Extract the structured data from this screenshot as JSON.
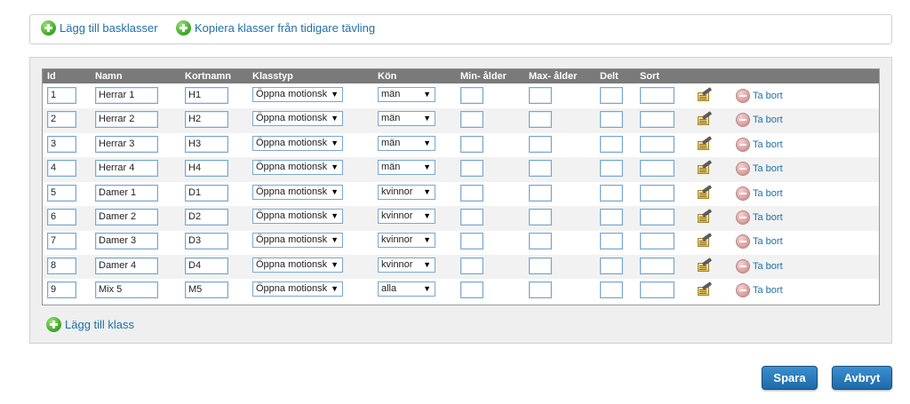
{
  "top_actions": {
    "add_base_classes": "Lägg till basklasser",
    "copy_classes": "Kopiera klasser från tidigare tävling"
  },
  "table": {
    "headers": {
      "id": "Id",
      "name": "Namn",
      "short_name": "Kortnamn",
      "class_type": "Klasstyp",
      "gender": "Kön",
      "min_age": "Min- ålder",
      "max_age": "Max- ålder",
      "split": "Delt",
      "sort": "Sort"
    },
    "rows": [
      {
        "id": "1",
        "name": "Herrar 1",
        "short": "H1",
        "type": "Öppna motionsk",
        "gender": "män",
        "min_age": "",
        "max_age": "",
        "split": "",
        "sort": ""
      },
      {
        "id": "2",
        "name": "Herrar 2",
        "short": "H2",
        "type": "Öppna motionsk",
        "gender": "män",
        "min_age": "",
        "max_age": "",
        "split": "",
        "sort": ""
      },
      {
        "id": "3",
        "name": "Herrar 3",
        "short": "H3",
        "type": "Öppna motionsk",
        "gender": "män",
        "min_age": "",
        "max_age": "",
        "split": "",
        "sort": ""
      },
      {
        "id": "4",
        "name": "Herrar 4",
        "short": "H4",
        "type": "Öppna motionsk",
        "gender": "män",
        "min_age": "",
        "max_age": "",
        "split": "",
        "sort": ""
      },
      {
        "id": "5",
        "name": "Damer 1",
        "short": "D1",
        "type": "Öppna motionsk",
        "gender": "kvinnor",
        "min_age": "",
        "max_age": "",
        "split": "",
        "sort": ""
      },
      {
        "id": "6",
        "name": "Damer 2",
        "short": "D2",
        "type": "Öppna motionsk",
        "gender": "kvinnor",
        "min_age": "",
        "max_age": "",
        "split": "",
        "sort": ""
      },
      {
        "id": "7",
        "name": "Damer 3",
        "short": "D3",
        "type": "Öppna motionsk",
        "gender": "kvinnor",
        "min_age": "",
        "max_age": "",
        "split": "",
        "sort": ""
      },
      {
        "id": "8",
        "name": "Damer 4",
        "short": "D4",
        "type": "Öppna motionsk",
        "gender": "kvinnor",
        "min_age": "",
        "max_age": "",
        "split": "",
        "sort": ""
      },
      {
        "id": "9",
        "name": "Mix 5",
        "short": "M5",
        "type": "Öppna motionsk",
        "gender": "alla",
        "min_age": "",
        "max_age": "",
        "split": "",
        "sort": ""
      }
    ],
    "delete_label": "Ta bort",
    "dropdown_arrow": "▼",
    "edit_icon": "edit-note-icon",
    "delete_icon": "minus-circle-icon"
  },
  "add_class": "Lägg till klass",
  "buttons": {
    "save": "Spara",
    "cancel": "Avbryt"
  },
  "colors": {
    "link": "#1f6fa8",
    "header_bg": "#7a7a7a",
    "button_bg": "#1f69a8",
    "add_icon": "#3aa524"
  }
}
